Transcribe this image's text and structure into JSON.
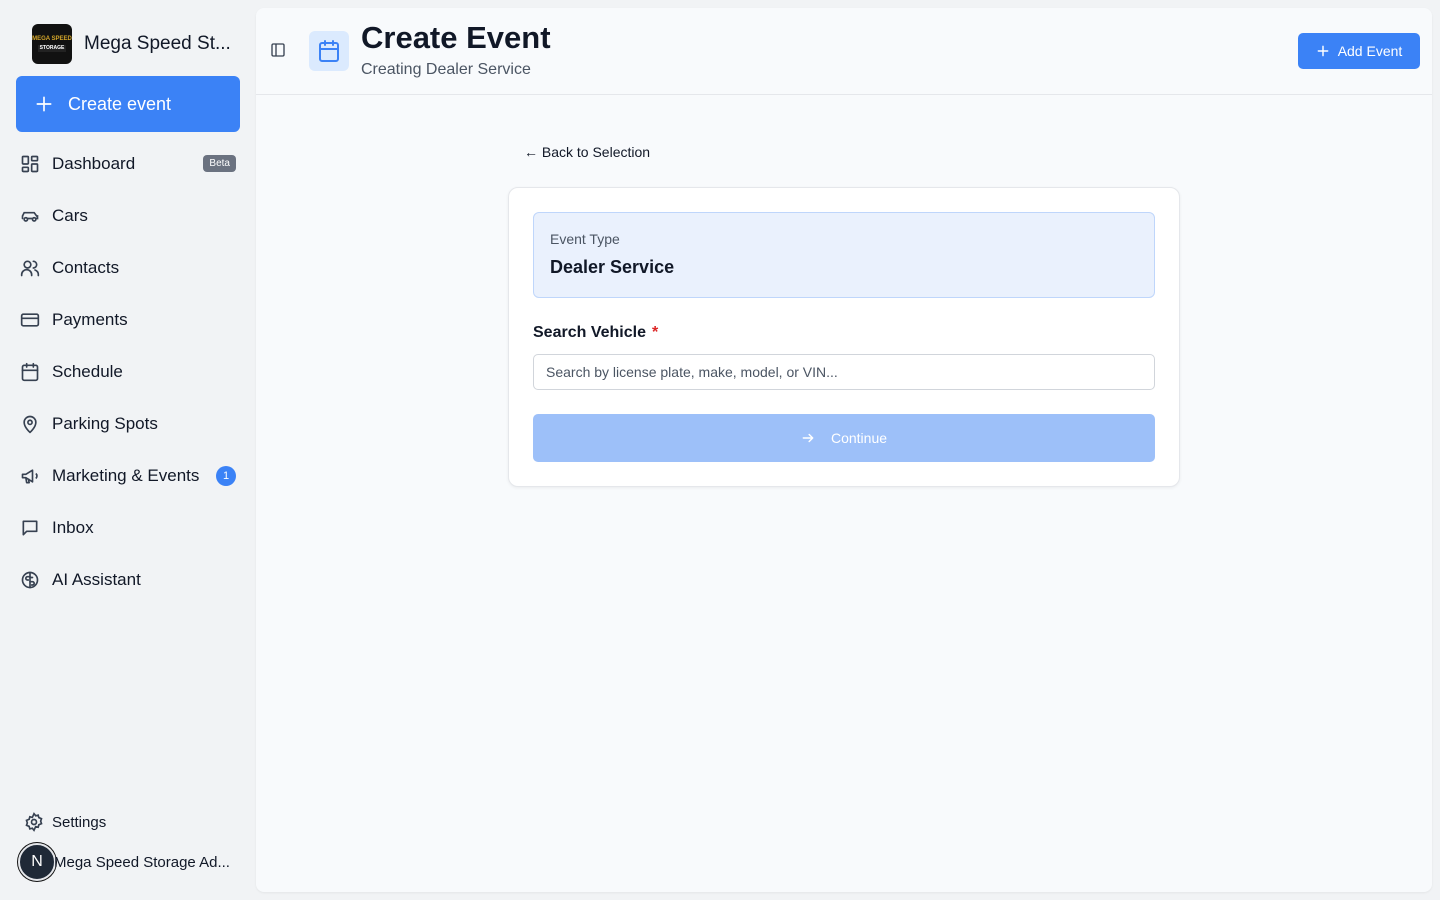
{
  "brand": {
    "name": "Mega Speed St...",
    "logo_text_top": "MEGA SPEED",
    "logo_text_bottom": "STORAGE"
  },
  "sidebar": {
    "create_label": "Create event",
    "items": [
      {
        "label": "Dashboard",
        "icon": "dashboard-icon",
        "badge": "Beta"
      },
      {
        "label": "Cars",
        "icon": "car-icon"
      },
      {
        "label": "Contacts",
        "icon": "users-icon"
      },
      {
        "label": "Payments",
        "icon": "credit-card-icon"
      },
      {
        "label": "Schedule",
        "icon": "calendar-icon"
      },
      {
        "label": "Parking Spots",
        "icon": "map-pin-icon"
      },
      {
        "label": "Marketing & Events",
        "icon": "megaphone-icon",
        "count": "1"
      },
      {
        "label": "Inbox",
        "icon": "message-square-icon"
      },
      {
        "label": "AI Assistant",
        "icon": "brain-icon"
      }
    ],
    "settings_label": "Settings",
    "user": {
      "initial": "N",
      "name": "Mega Speed Storage Ad..."
    }
  },
  "header": {
    "title": "Create Event",
    "subtitle": "Creating Dealer Service",
    "add_event_label": "Add Event"
  },
  "main": {
    "back_label": "← Back to Selection",
    "event_type_label": "Event Type",
    "event_type_value": "Dealer Service",
    "search_label": "Search Vehicle",
    "required_mark": "*",
    "search_placeholder": "Search by license plate, make, model, or VIN...",
    "continue_label": "Continue"
  },
  "colors": {
    "accent": "#3b82f6",
    "accent_disabled": "#9dc0f9",
    "required": "#dc2626",
    "type_box_bg": "#eaf1fd"
  }
}
